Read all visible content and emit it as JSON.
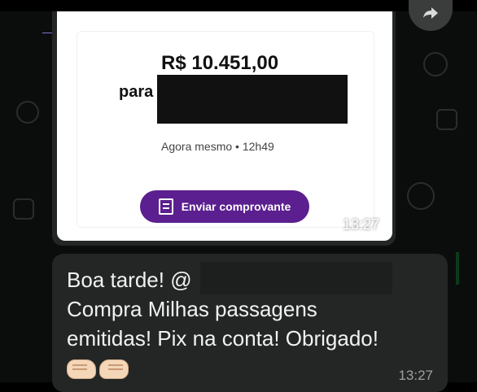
{
  "receipt": {
    "amount": "R$ 10.451,00",
    "recipient_prefix": "para",
    "timestamp_label": "Agora mesmo",
    "timestamp_separator": " • ",
    "timestamp_time": "12h49",
    "button_label": "Enviar comprovante",
    "accent_color": "#5b1f8f"
  },
  "image_message": {
    "time": "13:27"
  },
  "text_message": {
    "line1": "Boa tarde! @",
    "line2": "Compra Milhas passagens",
    "line3": "emitidas! Pix na conta! Obrigado!",
    "emojis": [
      "fist-left",
      "fist-right"
    ],
    "time": "13:27"
  },
  "icons": {
    "forward": "forward-icon",
    "document": "document-icon"
  }
}
